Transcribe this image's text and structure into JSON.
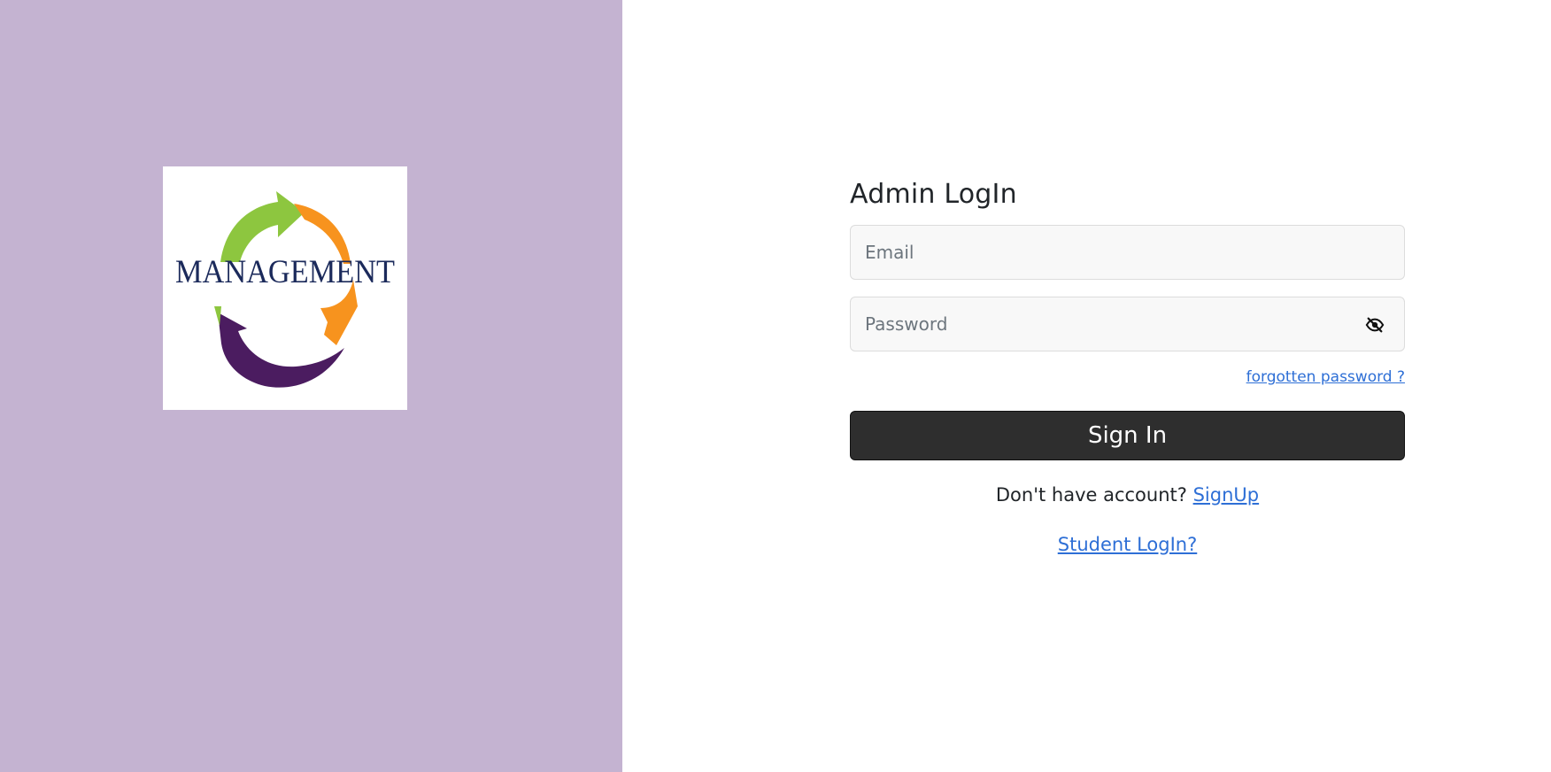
{
  "logo": {
    "text": "MANAGEMENT",
    "colors": {
      "green": "#8dc63f",
      "orange": "#f7931e",
      "purple": "#4b1c60",
      "navy": "#1b2a5b"
    }
  },
  "form": {
    "title": "Admin LogIn",
    "email_placeholder": "Email",
    "password_placeholder": "Password",
    "password_toggle_icon": "eye-slash-icon",
    "forgot_label": "forgotten password ?",
    "signin_label": "Sign In",
    "signup_prompt": "Don't have account?",
    "signup_label": "SignUp",
    "student_login_label": "Student LogIn?"
  },
  "theme": {
    "left_panel_bg": "#c4b3d1",
    "button_bg": "#2e2e2e",
    "link_color": "#2e6fd6"
  }
}
